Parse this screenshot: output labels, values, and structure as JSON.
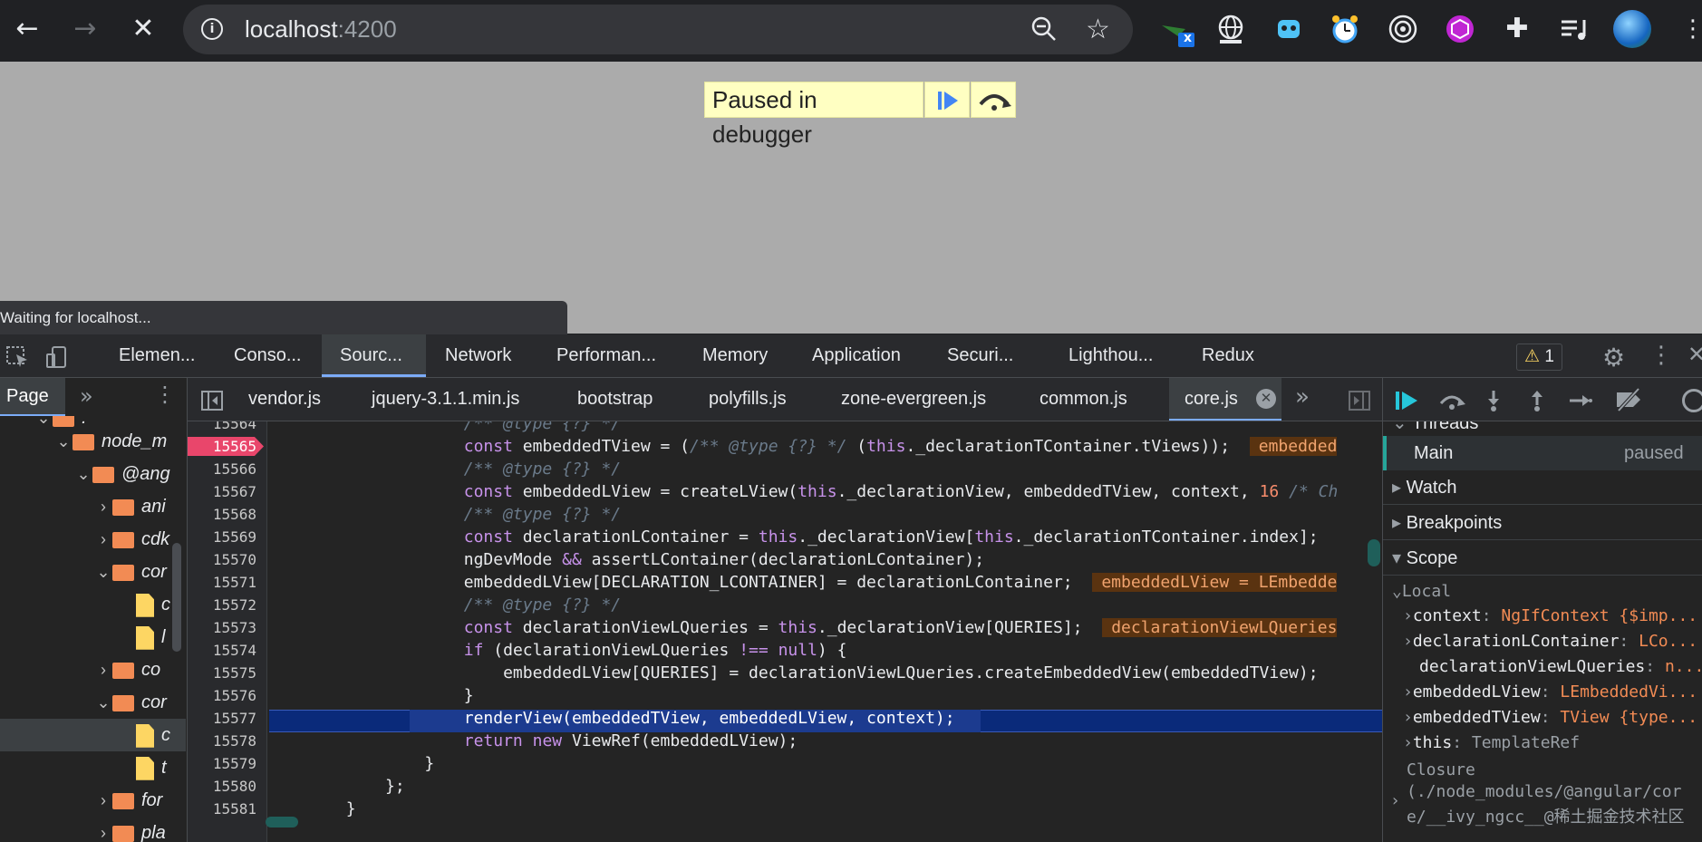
{
  "browser": {
    "url_host": "localhost",
    "url_port": ":4200",
    "ext_badge": "x"
  },
  "page": {
    "paused_text": "Paused in debugger",
    "status_text": "Waiting for localhost..."
  },
  "devtools": {
    "tabs": [
      "Elemen...",
      "Conso...",
      "Sourc...",
      "Network",
      "Performan...",
      "Memory",
      "Application",
      "Securi...",
      "Lighthou...",
      "Redux"
    ],
    "warning_count": "1"
  },
  "navigator": {
    "page_tab": "Page",
    "tree": [
      {
        "label": ".",
        "type": "folder"
      },
      {
        "label": "node_m",
        "type": "folder"
      },
      {
        "label": "@ang",
        "type": "folder"
      },
      {
        "label": "ani",
        "type": "folder"
      },
      {
        "label": "cdk",
        "type": "folder"
      },
      {
        "label": "cor",
        "type": "folder"
      },
      {
        "label": "c",
        "type": "file"
      },
      {
        "label": "l",
        "type": "file"
      },
      {
        "label": "co",
        "type": "folder"
      },
      {
        "label": "cor",
        "type": "folder"
      },
      {
        "label": "c",
        "type": "file"
      },
      {
        "label": "t",
        "type": "file"
      },
      {
        "label": "for",
        "type": "folder"
      },
      {
        "label": "pla",
        "type": "folder"
      }
    ]
  },
  "editor": {
    "file_tabs": [
      "vendor.js",
      "jquery-3.1.1.min.js",
      "bootstrap",
      "polyfills.js",
      "zone-evergreen.js",
      "common.js",
      "core.js"
    ],
    "active_file": "core.js",
    "breakpoint_line": "15565",
    "current_line": "15577",
    "line_numbers": [
      "15564",
      "15565",
      "15566",
      "15567",
      "15568",
      "15569",
      "15570",
      "15571",
      "15572",
      "15573",
      "15574",
      "15575",
      "15576",
      "15577",
      "15578",
      "15579",
      "15580",
      "15581"
    ]
  },
  "debugger": {
    "threads_label": "Threads",
    "main_thread": "Main",
    "main_status": "paused",
    "sections": [
      "Watch",
      "Breakpoints",
      "Scope"
    ],
    "local_label": "Local",
    "scope_vars": [
      {
        "name": "context",
        "value": "NgIfContext {$imp..."
      },
      {
        "name": "declarationLContainer",
        "value": "LCo..."
      },
      {
        "name": "declarationViewLQueries",
        "value": "n..."
      },
      {
        "name": "embeddedLView",
        "value": "LEmbeddedVi..."
      },
      {
        "name": "embeddedTView",
        "value": "TView {type..."
      },
      {
        "name": "this",
        "value": "TemplateRef"
      }
    ],
    "closure_label": "Closure",
    "closure_path1": "(./node_modules/@angular/cor",
    "closure_path2": "e/__ivy_ngcc__@稀土掘金技术社区"
  },
  "colors": {
    "accent": "#7cacf8",
    "breakpoint": "#e9466b",
    "highlight": "#0a2a7a"
  }
}
